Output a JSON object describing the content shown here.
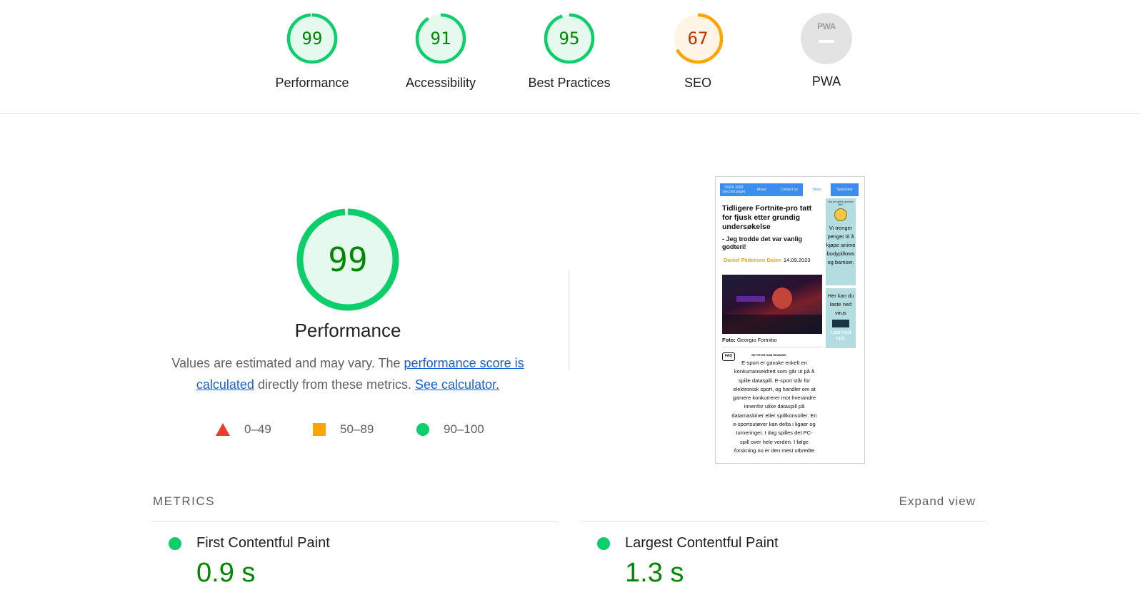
{
  "categories": [
    {
      "label": "Performance",
      "score": "99",
      "rating": "pass"
    },
    {
      "label": "Accessibility",
      "score": "91",
      "rating": "pass"
    },
    {
      "label": "Best Practices",
      "score": "95",
      "rating": "pass"
    },
    {
      "label": "SEO",
      "score": "67",
      "rating": "average"
    },
    {
      "label": "PWA",
      "score": "",
      "rating": "na",
      "badge_text": "PWA"
    }
  ],
  "performance": {
    "score": "99",
    "title": "Performance",
    "desc_prefix": "Values are estimated and may vary. The ",
    "link_score": "performance score is calculated",
    "desc_middle": " directly from these metrics. ",
    "link_calc": "See calculator."
  },
  "legend": [
    {
      "range": "0–49",
      "color": "#eb3c2d"
    },
    {
      "range": "50–89",
      "color": "#ffa400"
    },
    {
      "range": "90–100",
      "color": "#0cce6b"
    }
  ],
  "colors": {
    "pass": "#0cce6b",
    "average": "#ffa400",
    "fail": "#eb3c2d"
  },
  "thumbnail": {
    "nav": [
      "SVEN 1000 (second page)",
      "About",
      "Contact us",
      "Store",
      "Subscribe"
    ],
    "headline": "Tidligere Fortnite-pro tatt for fjusk etter grundig undersøkelse",
    "subheadline": "- Jeg trodde det var vanlig godteri!",
    "author": "Daniel Pedersen Dalen",
    "date": "14.09.2023",
    "caption_label": "Foto:",
    "caption_name": " Georgio Fortnitio",
    "faq": "FAQ",
    "faq_heading": "SETTE ER SUB HEADING",
    "body": "E-sport er ganske enkelt en konkurranseidrett som går ut på å spille dataspill. E-sport står for elektronisk sport, og handler om at gamere konkurrerer mot hverandre innenfor ulike dataspill på datamaskiner eller spillkonsoller. En e-sportsutøver kan delta i ligaer og turneringer. I dag spilles det PC-spill over hele verden. I følge forskning.no er den mest utbredte",
    "ad1_top": "Har du kjøft ti spennes ofte?",
    "ad1_text": "Vi trenger penger til å kjøpe anime bodypillows og bamser.",
    "ad2_text": "Her kan du laste ned virus",
    "ad2_link": "Last ned NÅ!"
  },
  "metrics": {
    "title": "METRICS",
    "expand": "Expand view",
    "items": [
      {
        "name": "First Contentful Paint",
        "value": "0.9 s"
      },
      {
        "name": "Largest Contentful Paint",
        "value": "1.3 s"
      }
    ]
  }
}
